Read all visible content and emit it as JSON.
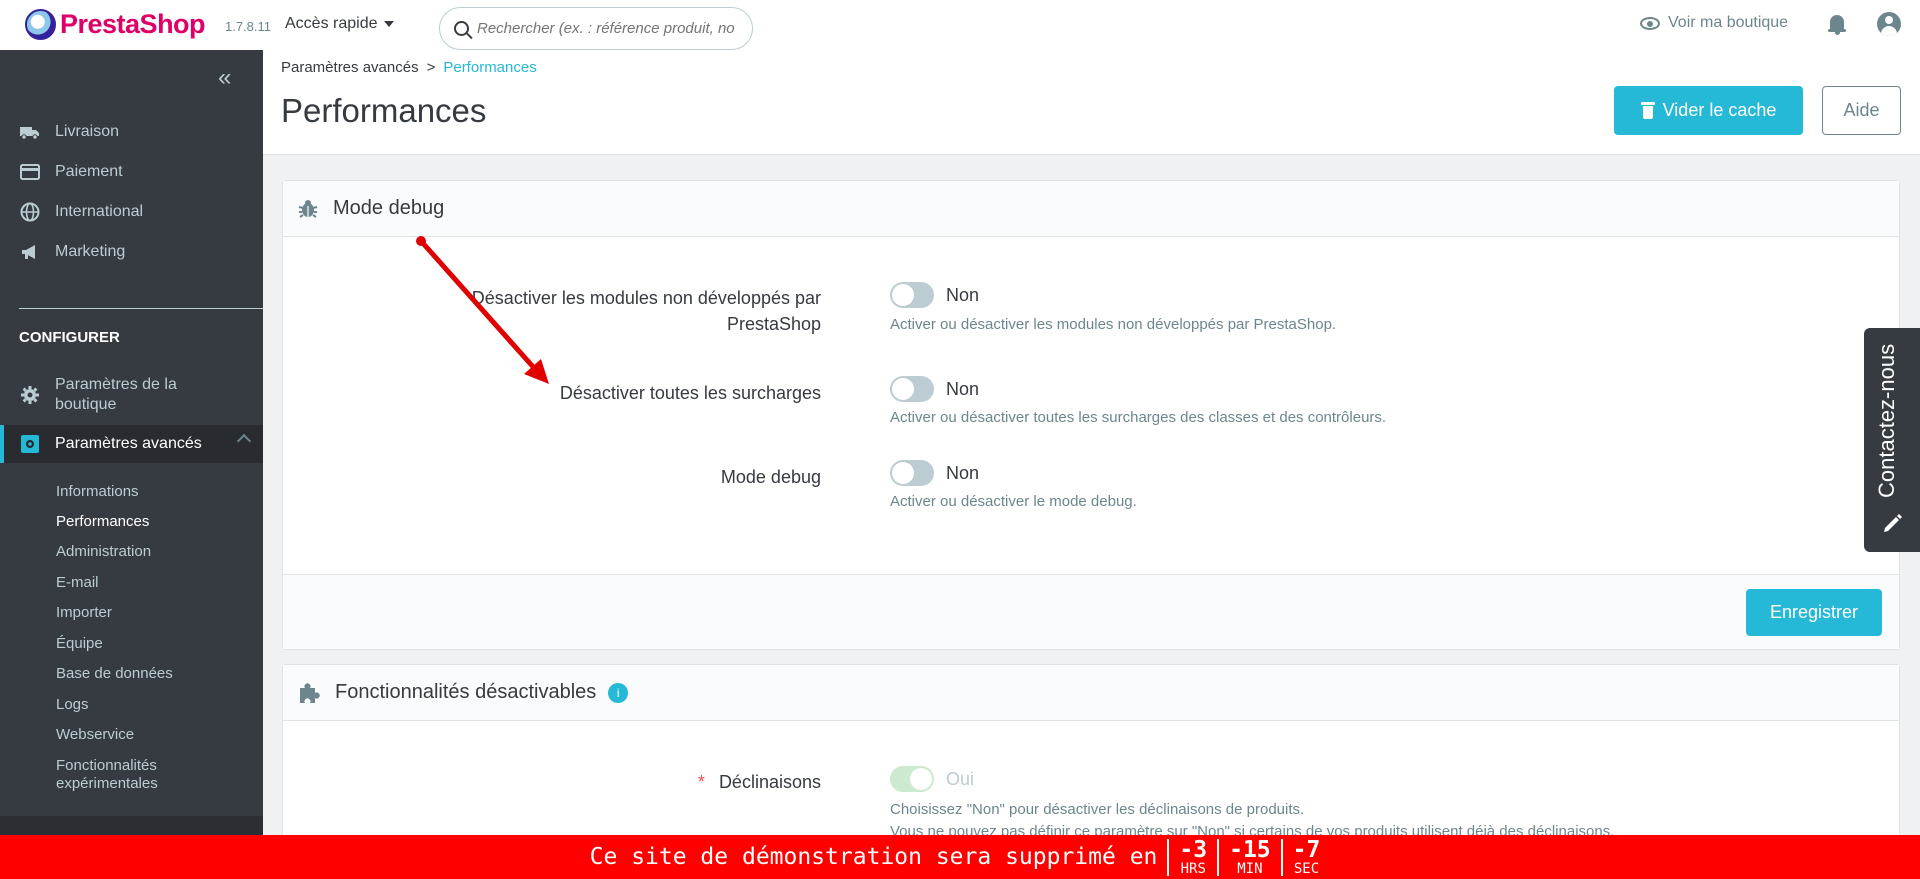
{
  "header": {
    "logo_text": "PrestaShop",
    "version": "1.7.8.11",
    "quick_access": "Accès rapide",
    "search_placeholder": "Rechercher (ex. : référence produit, no",
    "view_shop": "Voir ma boutique"
  },
  "sidebar": {
    "top_items": [
      {
        "label": "Livraison",
        "icon": "truck-icon"
      },
      {
        "label": "Paiement",
        "icon": "credit-card-icon"
      },
      {
        "label": "International",
        "icon": "globe-icon"
      },
      {
        "label": "Marketing",
        "icon": "megaphone-icon"
      }
    ],
    "section_title": "CONFIGURER",
    "config_items": [
      {
        "label": "Paramètres de la boutique",
        "icon": "gear-icon"
      },
      {
        "label": "Paramètres avancés",
        "icon": "settings-icon"
      }
    ],
    "sub_items": [
      "Informations",
      "Performances",
      "Administration",
      "E-mail",
      "Importer",
      "Équipe",
      "Base de données",
      "Logs",
      "Webservice",
      "Fonctionnalités expérimentales"
    ]
  },
  "page": {
    "breadcrumb_parent": "Paramètres avancés",
    "breadcrumb_sep": ">",
    "breadcrumb_current": "Performances",
    "title": "Performances",
    "clear_cache": "Vider le cache",
    "help": "Aide"
  },
  "debug_panel": {
    "title": "Mode debug",
    "rows": [
      {
        "label": "Désactiver les modules non développés par PrestaShop",
        "value": "Non",
        "help": "Activer ou désactiver les modules non développés par PrestaShop."
      },
      {
        "label": "Désactiver toutes les surcharges",
        "value": "Non",
        "help": "Activer ou désactiver toutes les surcharges des classes et des contrôleurs."
      },
      {
        "label": "Mode debug",
        "value": "Non",
        "help": "Activer ou désactiver le mode debug."
      }
    ],
    "save": "Enregistrer"
  },
  "features_panel": {
    "title": "Fonctionnalités désactivables",
    "info": "i",
    "row_label": "Déclinaisons",
    "required_mark": "*",
    "row_value": "Oui",
    "help_line1": "Choisissez \"Non\" pour désactiver les déclinaisons de produits.",
    "help_line2": "Vous ne pouvez pas définir ce paramètre sur \"Non\" si certains de vos produits utilisent déjà des déclinaisons."
  },
  "contact_tab": "Contactez-nous",
  "banner": {
    "text": "Ce site de démonstration sera supprimé en",
    "hours": "-3",
    "hours_unit": "HRS",
    "minutes": "-15",
    "minutes_unit": "MIN",
    "seconds": "-7",
    "seconds_unit": "SEC"
  },
  "colors": {
    "accent": "#25b9d7",
    "sidebar": "#363a41",
    "banner": "#fe0000",
    "arrow": "#e00000"
  }
}
